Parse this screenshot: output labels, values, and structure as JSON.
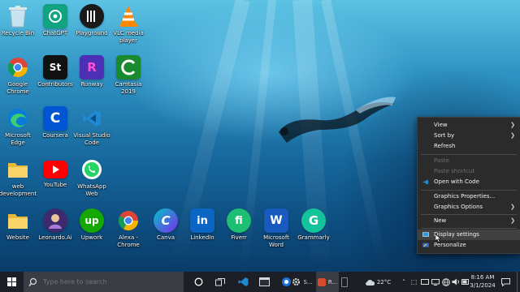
{
  "desktop": {
    "icons": [
      {
        "label": "Recycle Bin",
        "icon": "recycle-bin-icon"
      },
      {
        "label": "ChatGPT",
        "icon": "chatgpt-icon"
      },
      {
        "label": "Playground",
        "icon": "playground-icon"
      },
      {
        "label": "VLC media\nplayer",
        "icon": "vlc-icon"
      },
      {
        "label": "Google\nChrome",
        "icon": "chrome-icon"
      },
      {
        "label": "Contributors",
        "icon": "st-icon",
        "glyph": "St"
      },
      {
        "label": "Runway",
        "icon": "runway-icon",
        "glyph": "R"
      },
      {
        "label": "Camtasia\n2019",
        "icon": "camtasia-icon"
      },
      {
        "label": "Microsoft\nEdge",
        "icon": "edge-icon"
      },
      {
        "label": "Coursera",
        "icon": "coursera-icon",
        "glyph": "C"
      },
      {
        "label": "Visual Studio\nCode",
        "icon": "vscode-icon"
      },
      {
        "label": "web\ndevelopment",
        "icon": "folder-icon"
      },
      {
        "label": "YouTube",
        "icon": "youtube-icon"
      },
      {
        "label": "WhatsApp\nWeb",
        "icon": "whatsapp-icon"
      },
      {
        "label": "Website",
        "icon": "folder-icon"
      },
      {
        "label": "Leonardo.Ai",
        "icon": "leonardo-icon"
      },
      {
        "label": "Upwork",
        "icon": "upwork-icon",
        "glyph": "up"
      },
      {
        "label": "Alexa -\nChrome",
        "icon": "chrome-icon"
      },
      {
        "label": "Canva",
        "icon": "canva-icon",
        "glyph": "C"
      },
      {
        "label": "LinkedIn",
        "icon": "linkedin-icon",
        "glyph": "in"
      },
      {
        "label": "Fiverr",
        "icon": "fiverr-icon",
        "glyph": "fi"
      },
      {
        "label": "Microsoft\nWord",
        "icon": "word-icon",
        "glyph": "W"
      },
      {
        "label": "Grammarly",
        "icon": "grammarly-icon",
        "glyph": "G"
      }
    ]
  },
  "context_menu": {
    "items": [
      {
        "label": "View",
        "submenu": true
      },
      {
        "label": "Sort by",
        "submenu": true
      },
      {
        "label": "Refresh"
      },
      {
        "label": "Paste",
        "disabled": true
      },
      {
        "label": "Paste shortcut",
        "disabled": true
      },
      {
        "label": "Open with Code",
        "icon": "vscode-icon"
      },
      {
        "label": "Graphics Properties..."
      },
      {
        "label": "Graphics Options",
        "submenu": true
      },
      {
        "label": "New",
        "submenu": true
      },
      {
        "label": "Display settings",
        "icon": "display-icon",
        "highlighted": true
      },
      {
        "label": "Personalize",
        "icon": "personalize-icon"
      }
    ]
  },
  "taskbar": {
    "search_placeholder": "Type here to search",
    "apps": [
      "task-view",
      "vscode",
      "file-explorer",
      "browser",
      "settings",
      "recorder"
    ],
    "settings_label": "S...",
    "recorder_label": "R...",
    "weather": "22°C",
    "time": "8:16 AM",
    "date": "3/1/2024"
  },
  "colors": {
    "menu_bg": "#2b2b2b",
    "taskbar_bg": "#1c1f26",
    "accent": "#0078d4"
  }
}
